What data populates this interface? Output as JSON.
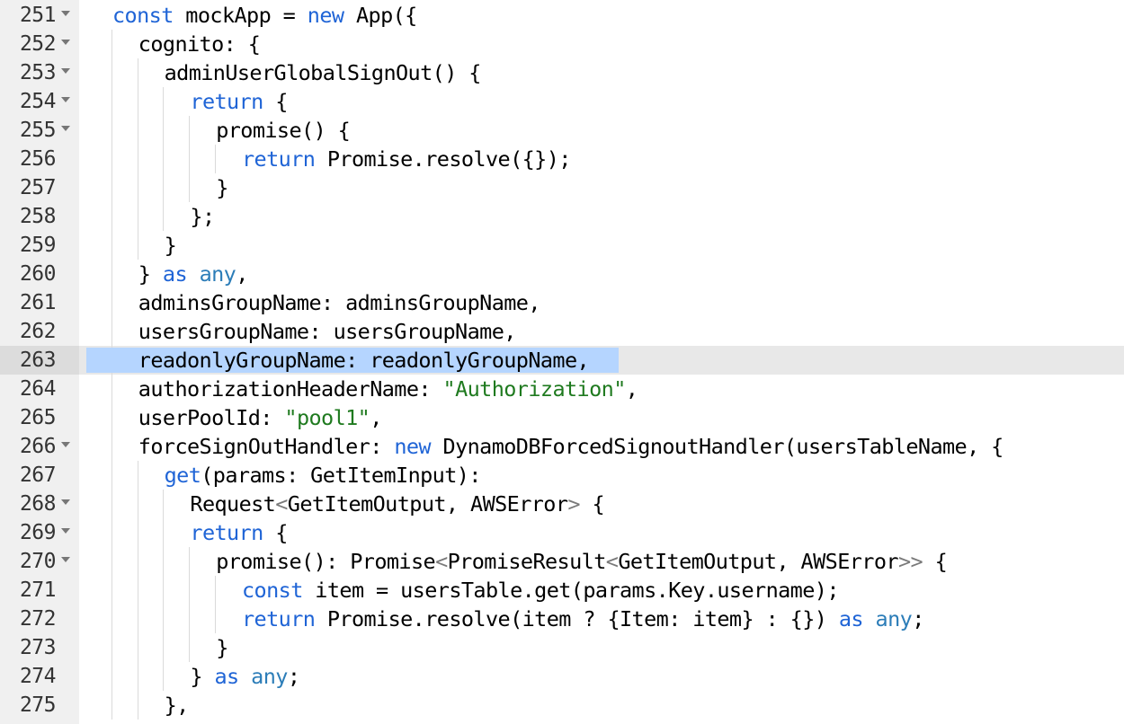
{
  "editor": {
    "active_line": "263",
    "lines": [
      {
        "n": "251",
        "fold": true,
        "indent": 1,
        "tokens": [
          {
            "t": "const",
            "k": "kw"
          },
          {
            "t": " mockApp = ",
            "k": "id"
          },
          {
            "t": "new",
            "k": "kw"
          },
          {
            "t": " App({",
            "k": "id"
          }
        ]
      },
      {
        "n": "252",
        "fold": true,
        "indent": 2,
        "tokens": [
          {
            "t": "cognito: {",
            "k": "id"
          }
        ]
      },
      {
        "n": "253",
        "fold": true,
        "indent": 3,
        "tokens": [
          {
            "t": "adminUserGlobalSignOut() {",
            "k": "id"
          }
        ]
      },
      {
        "n": "254",
        "fold": true,
        "indent": 4,
        "tokens": [
          {
            "t": "return",
            "k": "kw"
          },
          {
            "t": " {",
            "k": "id"
          }
        ]
      },
      {
        "n": "255",
        "fold": true,
        "indent": 5,
        "tokens": [
          {
            "t": "promise() {",
            "k": "id"
          }
        ]
      },
      {
        "n": "256",
        "fold": false,
        "indent": 6,
        "tokens": [
          {
            "t": "return",
            "k": "kw"
          },
          {
            "t": " Promise.resolve({});",
            "k": "id"
          }
        ]
      },
      {
        "n": "257",
        "fold": false,
        "indent": 5,
        "tokens": [
          {
            "t": "}",
            "k": "id"
          }
        ]
      },
      {
        "n": "258",
        "fold": false,
        "indent": 4,
        "tokens": [
          {
            "t": "};",
            "k": "id"
          }
        ]
      },
      {
        "n": "259",
        "fold": false,
        "indent": 3,
        "tokens": [
          {
            "t": "}",
            "k": "id"
          }
        ]
      },
      {
        "n": "260",
        "fold": false,
        "indent": 2,
        "tokens": [
          {
            "t": "} ",
            "k": "id"
          },
          {
            "t": "as",
            "k": "kw"
          },
          {
            "t": " ",
            "k": "id"
          },
          {
            "t": "any",
            "k": "any"
          },
          {
            "t": ",",
            "k": "id"
          }
        ]
      },
      {
        "n": "261",
        "fold": false,
        "indent": 2,
        "tokens": [
          {
            "t": "adminsGroupName: adminsGroupName,",
            "k": "id"
          }
        ]
      },
      {
        "n": "262",
        "fold": false,
        "indent": 2,
        "tokens": [
          {
            "t": "usersGroupName: usersGroupName,",
            "k": "id"
          }
        ]
      },
      {
        "n": "263",
        "fold": false,
        "indent": 2,
        "tokens": [
          {
            "t": "readonlyGroupName: readonlyGroupName,",
            "k": "id"
          }
        ]
      },
      {
        "n": "264",
        "fold": false,
        "indent": 2,
        "tokens": [
          {
            "t": "authorizationHeaderName: ",
            "k": "id"
          },
          {
            "t": "\"Authorization\"",
            "k": "str"
          },
          {
            "t": ",",
            "k": "id"
          }
        ]
      },
      {
        "n": "265",
        "fold": false,
        "indent": 2,
        "tokens": [
          {
            "t": "userPoolId: ",
            "k": "id"
          },
          {
            "t": "\"pool1\"",
            "k": "str"
          },
          {
            "t": ",",
            "k": "id"
          }
        ]
      },
      {
        "n": "266",
        "fold": true,
        "indent": 2,
        "tokens": [
          {
            "t": "forceSignOutHandler: ",
            "k": "id"
          },
          {
            "t": "new",
            "k": "kw"
          },
          {
            "t": " DynamoDBForcedSignoutHandler(usersTableName, {",
            "k": "id"
          }
        ]
      },
      {
        "n": "267",
        "fold": false,
        "indent": 3,
        "tokens": [
          {
            "t": "get",
            "k": "kw"
          },
          {
            "t": "(params: GetItemInput):",
            "k": "id"
          }
        ]
      },
      {
        "n": "268",
        "fold": true,
        "indent": 4,
        "tokens": [
          {
            "t": "Request",
            "k": "id"
          },
          {
            "t": "<",
            "k": "op"
          },
          {
            "t": "GetItemOutput, AWSError",
            "k": "id"
          },
          {
            "t": ">",
            "k": "op"
          },
          {
            "t": " {",
            "k": "id"
          }
        ]
      },
      {
        "n": "269",
        "fold": true,
        "indent": 4,
        "tokens": [
          {
            "t": "return",
            "k": "kw"
          },
          {
            "t": " {",
            "k": "id"
          }
        ]
      },
      {
        "n": "270",
        "fold": true,
        "indent": 5,
        "tokens": [
          {
            "t": "promise(): Promise",
            "k": "id"
          },
          {
            "t": "<",
            "k": "op"
          },
          {
            "t": "PromiseResult",
            "k": "id"
          },
          {
            "t": "<",
            "k": "op"
          },
          {
            "t": "GetItemOutput, AWSError",
            "k": "id"
          },
          {
            "t": ">>",
            "k": "op"
          },
          {
            "t": " {",
            "k": "id"
          }
        ]
      },
      {
        "n": "271",
        "fold": false,
        "indent": 6,
        "tokens": [
          {
            "t": "const",
            "k": "kw"
          },
          {
            "t": " item = usersTable.get(params.Key.username);",
            "k": "id"
          }
        ]
      },
      {
        "n": "272",
        "fold": false,
        "indent": 6,
        "tokens": [
          {
            "t": "return",
            "k": "kw"
          },
          {
            "t": " Promise.resolve(item ? {Item: item} : {}) ",
            "k": "id"
          },
          {
            "t": "as",
            "k": "kw"
          },
          {
            "t": " ",
            "k": "id"
          },
          {
            "t": "any",
            "k": "any"
          },
          {
            "t": ";",
            "k": "id"
          }
        ]
      },
      {
        "n": "273",
        "fold": false,
        "indent": 5,
        "tokens": [
          {
            "t": "}",
            "k": "id"
          }
        ]
      },
      {
        "n": "274",
        "fold": false,
        "indent": 4,
        "tokens": [
          {
            "t": "} ",
            "k": "id"
          },
          {
            "t": "as",
            "k": "kw"
          },
          {
            "t": " ",
            "k": "id"
          },
          {
            "t": "any",
            "k": "any"
          },
          {
            "t": ";",
            "k": "id"
          }
        ]
      },
      {
        "n": "275",
        "fold": false,
        "indent": 3,
        "tokens": [
          {
            "t": "},",
            "k": "id"
          }
        ]
      }
    ],
    "colors": {
      "keyword": "#1f64d6",
      "string": "#1f7a1f",
      "any_type": "#2c7db8",
      "selection": "#b5d5ff",
      "active_line": "#e8e8e8",
      "gutter": "#f0f0f0"
    },
    "icons": {
      "fold": "fold-arrow-icon"
    }
  }
}
